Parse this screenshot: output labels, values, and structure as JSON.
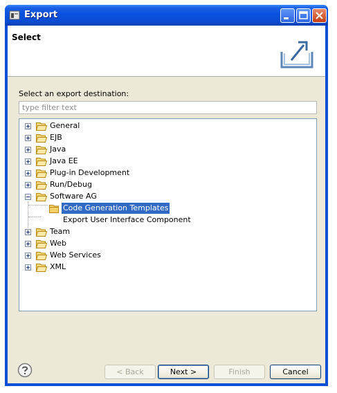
{
  "window": {
    "title": "Export"
  },
  "header": {
    "title": "Select"
  },
  "prompt": "Select an export destination:",
  "filter": {
    "placeholder": "type filter text",
    "value": ""
  },
  "tree": {
    "items": [
      {
        "label": "General",
        "expanded": false
      },
      {
        "label": "EJB",
        "expanded": false
      },
      {
        "label": "Java",
        "expanded": false
      },
      {
        "label": "Java EE",
        "expanded": false
      },
      {
        "label": "Plug-in Development",
        "expanded": false
      },
      {
        "label": "Run/Debug",
        "expanded": false
      },
      {
        "label": "Software AG",
        "expanded": true
      },
      {
        "label": "Code Generation Templates",
        "child": true,
        "selected": true
      },
      {
        "label": "Export User Interface Component",
        "child": true
      },
      {
        "label": "Team",
        "expanded": false
      },
      {
        "label": "Web",
        "expanded": false
      },
      {
        "label": "Web Services",
        "expanded": false
      },
      {
        "label": "XML",
        "expanded": false
      }
    ]
  },
  "buttons": {
    "back": "< Back",
    "next": "Next >",
    "finish": "Finish",
    "cancel": "Cancel"
  },
  "icons": {
    "help": "help-icon",
    "export": "export-icon",
    "folder": "folder-icon",
    "app": "eclipse-app-icon"
  },
  "colors": {
    "titlebar": "#0a4cd2",
    "selection": "#316ac5",
    "dialog_bg": "#ece9d8"
  }
}
